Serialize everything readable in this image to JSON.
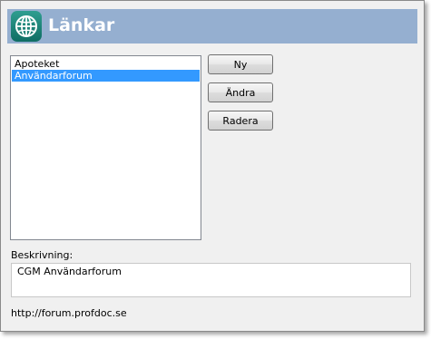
{
  "header": {
    "title": "Länkar",
    "icon": "globe-icon"
  },
  "links": {
    "items": [
      {
        "label": "Apoteket",
        "selected": false
      },
      {
        "label": "Användarforum",
        "selected": true
      }
    ]
  },
  "buttons": {
    "new_label": "Ny",
    "edit_label": "Ändra",
    "delete_label": "Radera"
  },
  "description": {
    "label": "Beskrivning:",
    "value": "CGM Användarforum"
  },
  "url": "http://forum.profdoc.se",
  "colors": {
    "header_bg": "#95afd0",
    "selection": "#3399ff",
    "icon_bg": "#1f8a7d"
  }
}
